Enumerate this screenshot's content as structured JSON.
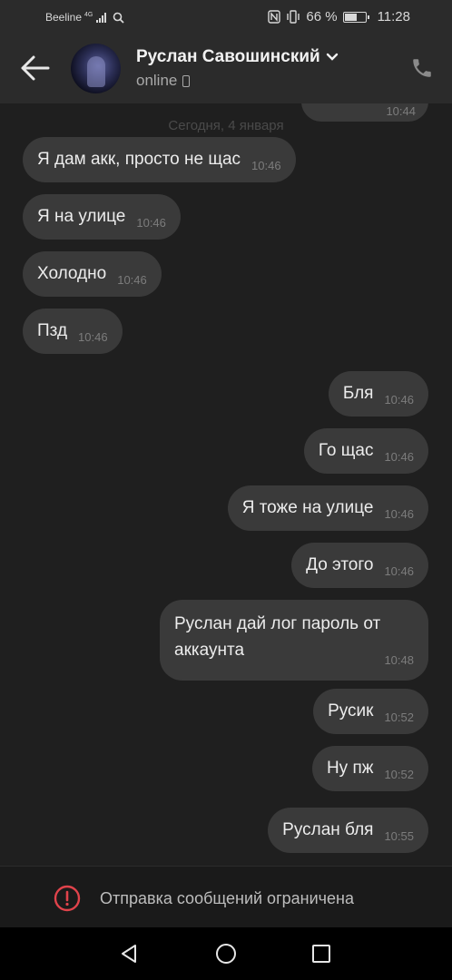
{
  "status_bar": {
    "carrier": "Beeline",
    "network": "4G",
    "battery_percent": "66 %",
    "battery_level": 0.66,
    "time": "11:28",
    "icons": [
      "search-icon",
      "nfc-icon",
      "vibrate-icon",
      "battery-icon"
    ]
  },
  "header": {
    "contact_name": "Руслан Савошинский",
    "status": "online",
    "icons": [
      "back-arrow-icon",
      "chevron-down-icon",
      "mobile-device-icon",
      "phone-call-icon"
    ]
  },
  "chat": {
    "partial_top_time": "10:44",
    "date_separator": "Сегодня, 4 января",
    "messages": [
      {
        "side": "in",
        "text": "Я дам акк, просто не щас",
        "time": "10:46"
      },
      {
        "side": "in",
        "text": "Я на улице",
        "time": "10:46"
      },
      {
        "side": "in",
        "text": "Холодно",
        "time": "10:46"
      },
      {
        "side": "in",
        "text": "Пзд",
        "time": "10:46"
      },
      {
        "side": "out",
        "text": "Бля",
        "time": "10:46"
      },
      {
        "side": "out",
        "text": "Го щас",
        "time": "10:46"
      },
      {
        "side": "out",
        "text": "Я тоже на улице",
        "time": "10:46"
      },
      {
        "side": "out",
        "text": "До этого",
        "time": "10:46"
      },
      {
        "side": "out",
        "text": "Руслан дай лог пароль от аккаунта",
        "time": "10:48"
      },
      {
        "side": "out",
        "text": "Русик",
        "time": "10:52"
      },
      {
        "side": "out",
        "text": "Ну пж",
        "time": "10:52"
      },
      {
        "side": "out",
        "text": "Руслан бля",
        "time": "10:55"
      }
    ]
  },
  "restriction": {
    "text": "Отправка сообщений ограничена",
    "icon": "warning-circle-icon",
    "accent": "#e0434b"
  },
  "navigation": {
    "icons": [
      "back-triangle-icon",
      "home-circle-icon",
      "recents-square-icon"
    ]
  }
}
